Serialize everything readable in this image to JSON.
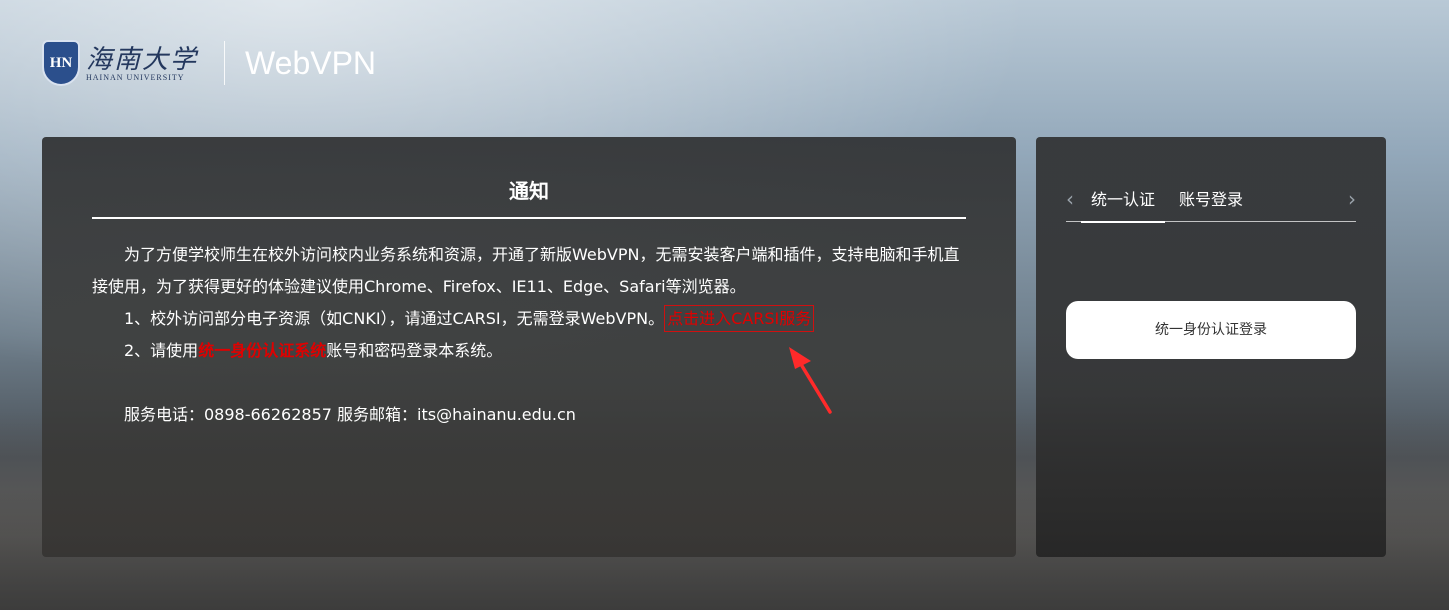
{
  "header": {
    "logo_emblem_text": "HN",
    "logo_cn": "海南大学",
    "logo_en": "HAINAN UNIVERSITY",
    "app_title": "WebVPN"
  },
  "notice": {
    "title": "通知",
    "para1": "为了方便学校师生在校外访问校内业务系统和资源，开通了新版WebVPN，无需安装客户端和插件，支持电脑和手机直接使用，为了获得更好的体验建议使用Chrome、Firefox、IE11、Edge、Safari等浏览器。",
    "item1_text": "1、校外访问部分电子资源（如CNKI），请通过CARSI，无需登录WebVPN。",
    "item1_link": "点击进入CARSI服务",
    "item2_prefix": "2、请使用",
    "item2_link": "统一身份认证系统",
    "item2_suffix": "账号和密码登录本系统。",
    "contact": "服务电话：0898-66262857 服务邮箱：its@hainanu.edu.cn"
  },
  "login": {
    "prev_icon": "‹",
    "next_icon": "›",
    "tabs": [
      "统一认证",
      "账号登录"
    ],
    "active_tab": 0,
    "button_label": "统一身份认证登录"
  },
  "colors": {
    "link_red": "#e00000",
    "arrow_red": "#ff2a2a",
    "logo_blue": "#24385e"
  }
}
